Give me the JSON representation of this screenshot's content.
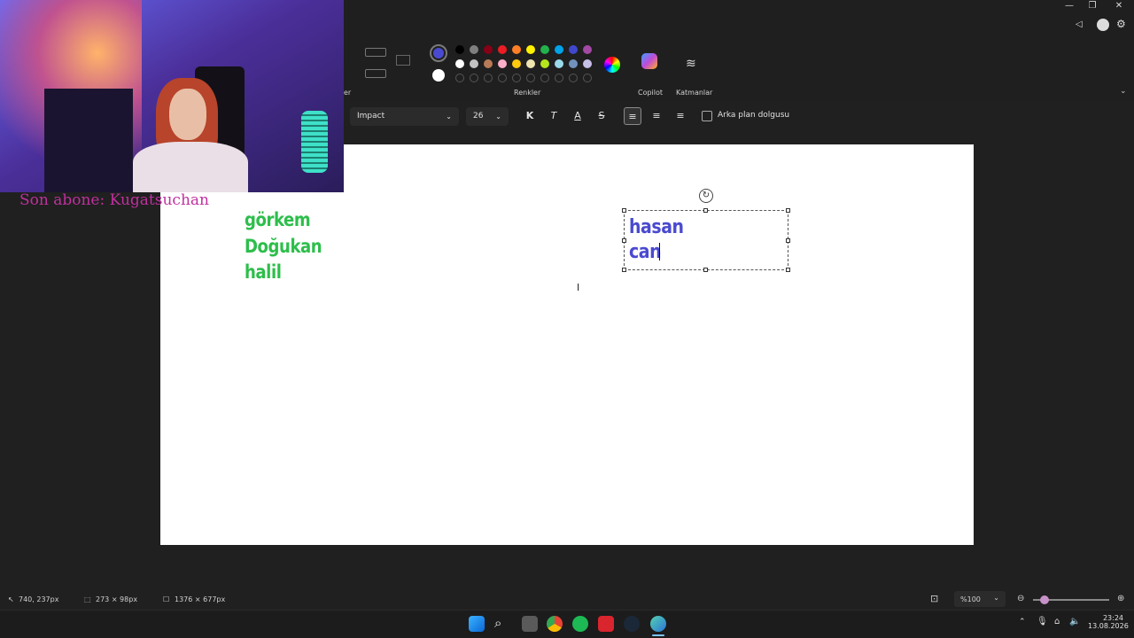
{
  "overlay": {
    "last_subscriber": "Son abone: Kugatsuchan"
  },
  "ribbon": {
    "colors_label": "Renkler",
    "copilot_label": "Copilot",
    "layers_label": "Katmanlar",
    "left_partial_label": "er",
    "palette_row1": [
      "#000000",
      "#7f7f7f",
      "#880015",
      "#ed1c24",
      "#ff7f27",
      "#fff200",
      "#22b14c",
      "#00a2e8",
      "#3f48cc",
      "#a349a4"
    ],
    "palette_row2": [
      "#ffffff",
      "#c3c3c3",
      "#b97a57",
      "#ffaec9",
      "#ffc90e",
      "#efe4b0",
      "#b5e61d",
      "#99d9ea",
      "#7092be",
      "#c8bfe7"
    ],
    "primary_color": "#4a4ad0",
    "secondary_color": "#ffffff"
  },
  "format": {
    "font": "Impact",
    "size": "26",
    "bold_label": "K",
    "italic_label": "T",
    "color_label": "A",
    "strike_label": "S",
    "bg_fill_label": "Arka plan dolgusu"
  },
  "canvas": {
    "green_lines": [
      "görkem",
      "Doğukan",
      "halil"
    ],
    "blue_lines": [
      "hasan",
      "can"
    ],
    "green_color": "#2dbe4b",
    "blue_color": "#4a4ad0"
  },
  "status": {
    "cursor_pos": "740, 237px",
    "selection_size": "273 × 98px",
    "canvas_size": "1376 × 677px",
    "zoom": "%100"
  },
  "taskbar": {
    "time": "23:24",
    "date": "13.08.2026"
  }
}
